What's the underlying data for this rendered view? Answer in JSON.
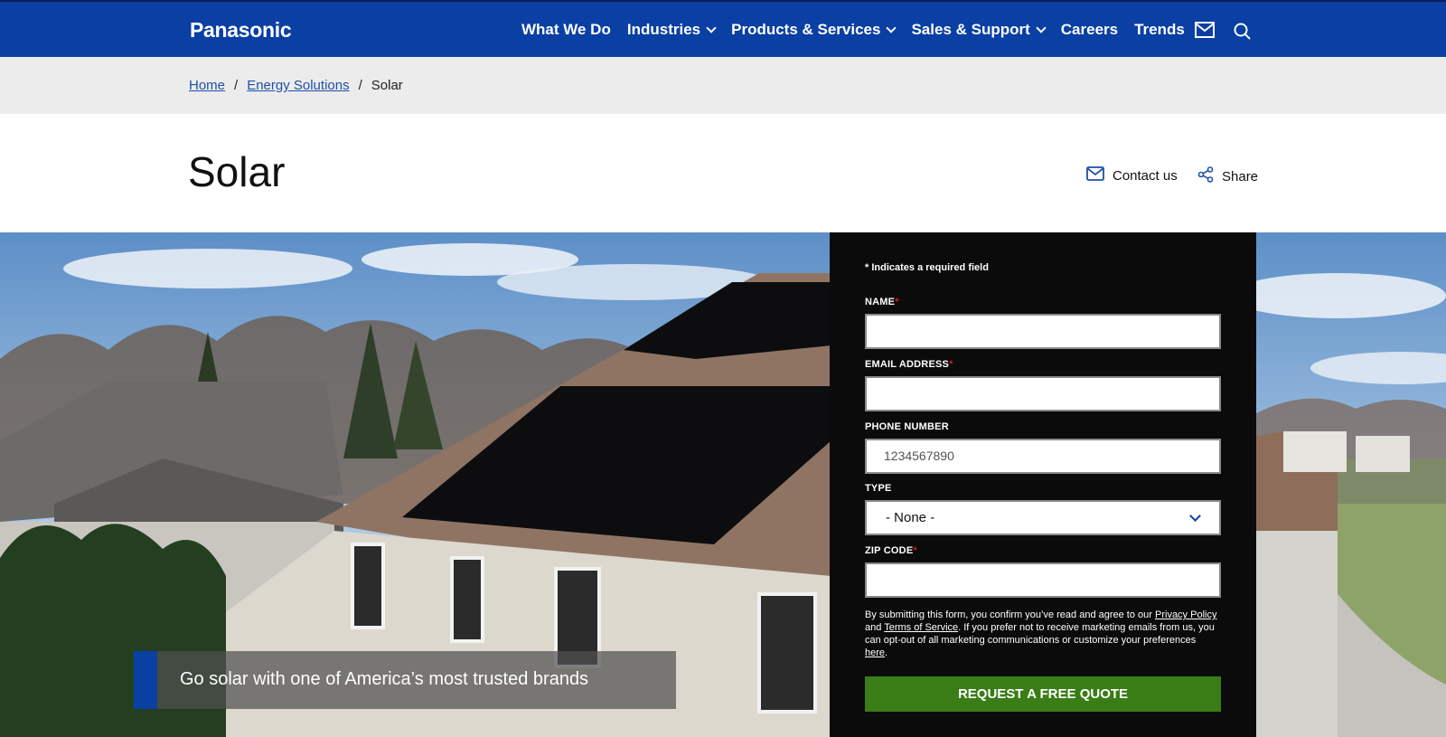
{
  "header": {
    "logo": "Panasonic",
    "nav": [
      {
        "label": "What We Do",
        "dropdown": false
      },
      {
        "label": "Industries",
        "dropdown": true
      },
      {
        "label": "Products & Services",
        "dropdown": true
      },
      {
        "label": "Sales & Support",
        "dropdown": true
      },
      {
        "label": "Careers",
        "dropdown": false
      },
      {
        "label": "Trends",
        "dropdown": false
      }
    ],
    "icons": [
      "mail-icon",
      "search-icon"
    ],
    "brand_color": "#0a3fa3"
  },
  "breadcrumb": {
    "items": [
      "Home",
      "Energy Solutions"
    ],
    "current": "Solar"
  },
  "page": {
    "title": "Solar",
    "contact_label": "Contact us",
    "share_label": "Share"
  },
  "hero": {
    "tagline": "Go solar with one of America’s most trusted brands"
  },
  "form": {
    "required_note": "* Indicates a required field",
    "name_label": "NAME",
    "email_label": "EMAIL ADDRESS",
    "phone_label": "PHONE NUMBER",
    "phone_placeholder": "1234567890",
    "type_label": "TYPE",
    "type_value": "- None -",
    "zip_label": "ZIP CODE",
    "required_mark": "*",
    "disclaimer_1": "By submitting this form, you confirm you’ve read and agree to our ",
    "privacy_link": "Privacy Policy",
    "disclaimer_2": " and ",
    "terms_link": "Terms of Service",
    "disclaimer_3": ". If you prefer not to receive marketing emails from us, you can opt-out of all marketing communications or customize your preferences ",
    "here_link": "here",
    "disclaimer_4": ".",
    "submit_label": "REQUEST A FREE QUOTE",
    "submit_color": "#3a7d17"
  }
}
